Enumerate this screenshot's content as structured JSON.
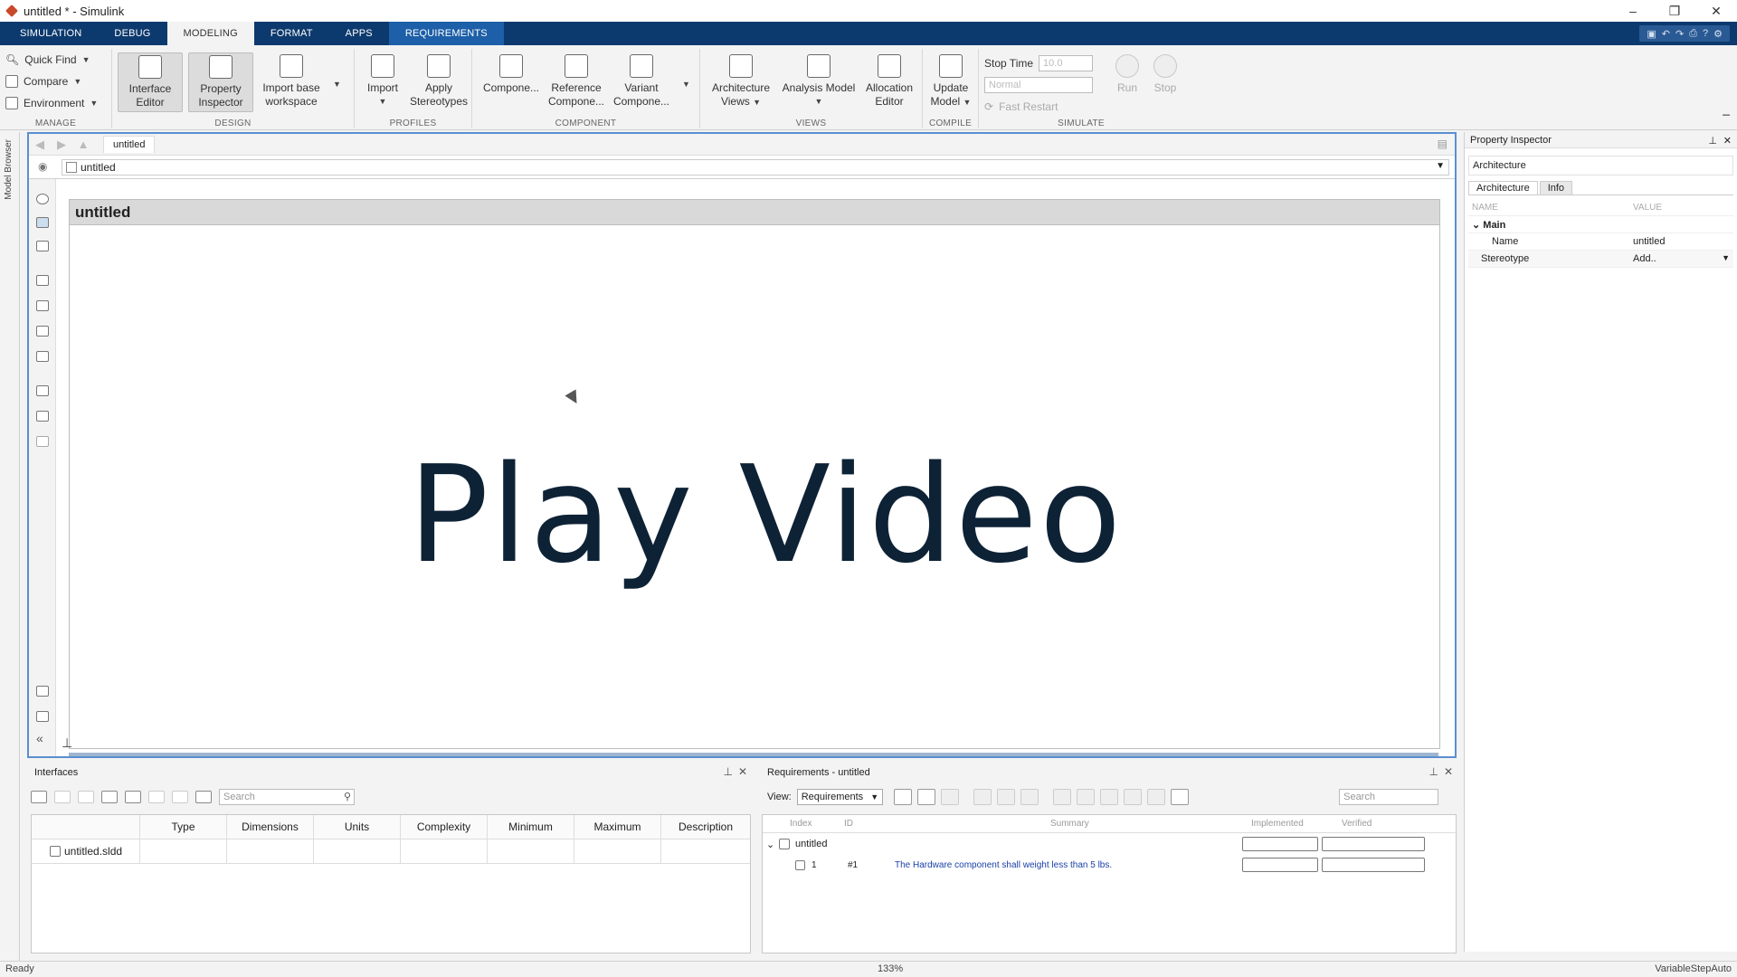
{
  "window": {
    "title": "untitled * - Simulink",
    "min": "–",
    "restore": "❐",
    "close": "✕"
  },
  "tabs": [
    {
      "label": "SIMULATION"
    },
    {
      "label": "DEBUG"
    },
    {
      "label": "MODELING"
    },
    {
      "label": "FORMAT"
    },
    {
      "label": "APPS"
    },
    {
      "label": "REQUIREMENTS"
    }
  ],
  "quick_access": {
    "help": "?"
  },
  "ribbon": {
    "manage": {
      "label": "MANAGE",
      "quick_find": "Quick Find",
      "compare": "Compare",
      "environment": "Environment"
    },
    "design": {
      "label": "DESIGN",
      "interface_editor": [
        "Interface",
        "Editor"
      ],
      "property_inspector": [
        "Property",
        "Inspector"
      ],
      "import_base": [
        "Import base",
        "workspace"
      ]
    },
    "profiles": {
      "label": "PROFILES",
      "import": "Import",
      "apply_stereotypes": [
        "Apply",
        "Stereotypes"
      ]
    },
    "component": {
      "label": "COMPONENT",
      "component": "Compone...",
      "reference": [
        "Reference",
        "Compone..."
      ],
      "variant": [
        "Variant",
        "Compone..."
      ]
    },
    "views": {
      "label": "VIEWS",
      "architecture_views": [
        "Architecture",
        "Views"
      ],
      "analysis_model": [
        "Analysis Model"
      ],
      "allocation_editor": [
        "Allocation",
        "Editor"
      ]
    },
    "compile": {
      "label": "COMPILE",
      "update_model": [
        "Update",
        "Model"
      ]
    },
    "simulate": {
      "label": "SIMULATE",
      "stop_time_label": "Stop Time",
      "stop_time_value": "10.0",
      "mode": "Normal",
      "fast_restart": "Fast Restart",
      "run": "Run",
      "stop": "Stop"
    }
  },
  "model_browser": {
    "label": "Model Browser"
  },
  "canvas": {
    "tab": "untitled",
    "address": "untitled",
    "block_title": "untitled",
    "overlay_text": "Play Video"
  },
  "property_inspector": {
    "title": "Property Inspector",
    "context": "Architecture",
    "tabs": [
      "Architecture",
      "Info"
    ],
    "col_name": "NAME",
    "col_value": "VALUE",
    "section": "Main",
    "rows": [
      {
        "name": "Name",
        "value": "untitled"
      },
      {
        "name": "Stereotype",
        "value": "Add.."
      }
    ]
  },
  "interfaces": {
    "title": "Interfaces",
    "search_placeholder": "Search",
    "columns": [
      "Type",
      "Dimensions",
      "Units",
      "Complexity",
      "Minimum",
      "Maximum",
      "Description"
    ],
    "rows": [
      {
        "name": "untitled.sldd"
      }
    ]
  },
  "requirements": {
    "title": "Requirements - untitled",
    "view_label": "View:",
    "view_value": "Requirements",
    "search_placeholder": "Search",
    "columns": [
      "Index",
      "ID",
      "Summary",
      "Implemented",
      "Verified"
    ],
    "root": "untitled",
    "items": [
      {
        "index": "1",
        "id": "#1",
        "summary": "The Hardware component shall weight less than 5 lbs."
      }
    ]
  },
  "status": {
    "left": "Ready",
    "zoom": "133%",
    "solver": "VariableStepAuto"
  },
  "colors": {
    "tab_bar": "#0d3a6e",
    "requirements_tab": "#1d5fa8",
    "selection_border": "#5a8fd0",
    "link_text": "#1a3fa8"
  }
}
